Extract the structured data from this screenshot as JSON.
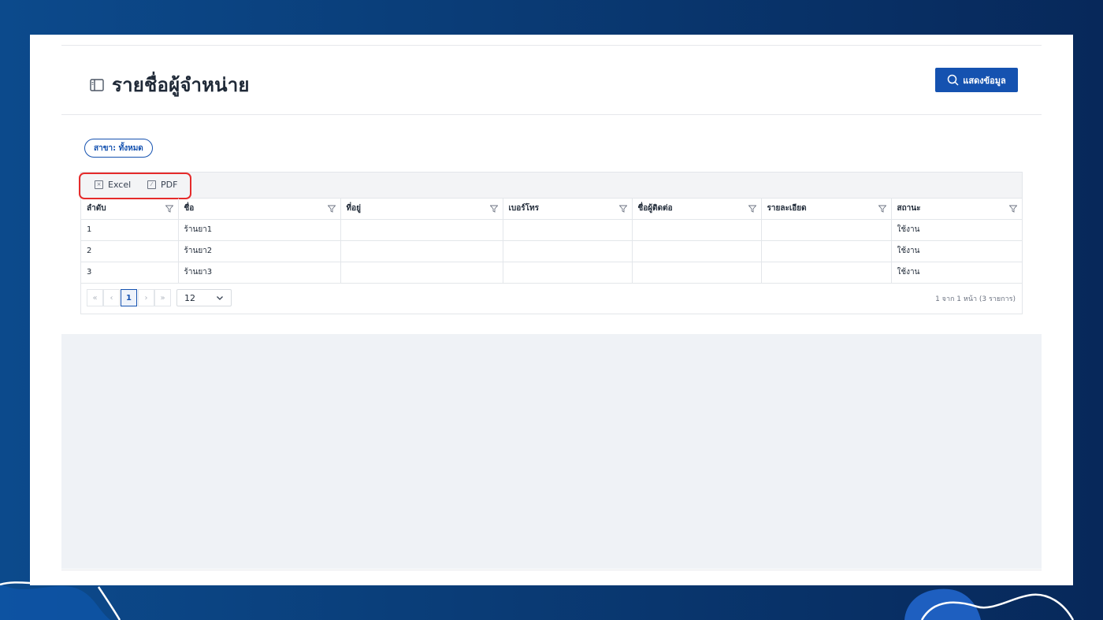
{
  "page": {
    "title": "รายชื่อผู้จำหน่าย",
    "show_button_label": "แสดงข้อมูล",
    "branch_filter": "สาขา: ทั้งหมด"
  },
  "toolbar": {
    "excel_label": "Excel",
    "pdf_label": "PDF"
  },
  "table": {
    "columns": [
      "ลำดับ",
      "ชื่อ",
      "ที่อยู่",
      "เบอร์โทร",
      "ชื่อผู้ติดต่อ",
      "รายละเอียด",
      "สถานะ"
    ],
    "rows": [
      [
        "1",
        "ร้านยา1",
        "",
        "",
        "",
        "",
        "ใช้งาน"
      ],
      [
        "2",
        "ร้านยา2",
        "",
        "",
        "",
        "",
        "ใช้งาน"
      ],
      [
        "3",
        "ร้านยา3",
        "",
        "",
        "",
        "",
        "ใช้งาน"
      ]
    ]
  },
  "pager": {
    "first": "«",
    "prev": "‹",
    "current_page": "1",
    "next": "›",
    "last": "»",
    "page_size": "12",
    "info": "1 จาก 1 หน้า (3 รายการ)"
  },
  "colors": {
    "primary": "#1552b0",
    "highlight": "#e52b2b",
    "background_gradient_start": "#0c4a8c",
    "background_gradient_end": "#07285a"
  }
}
